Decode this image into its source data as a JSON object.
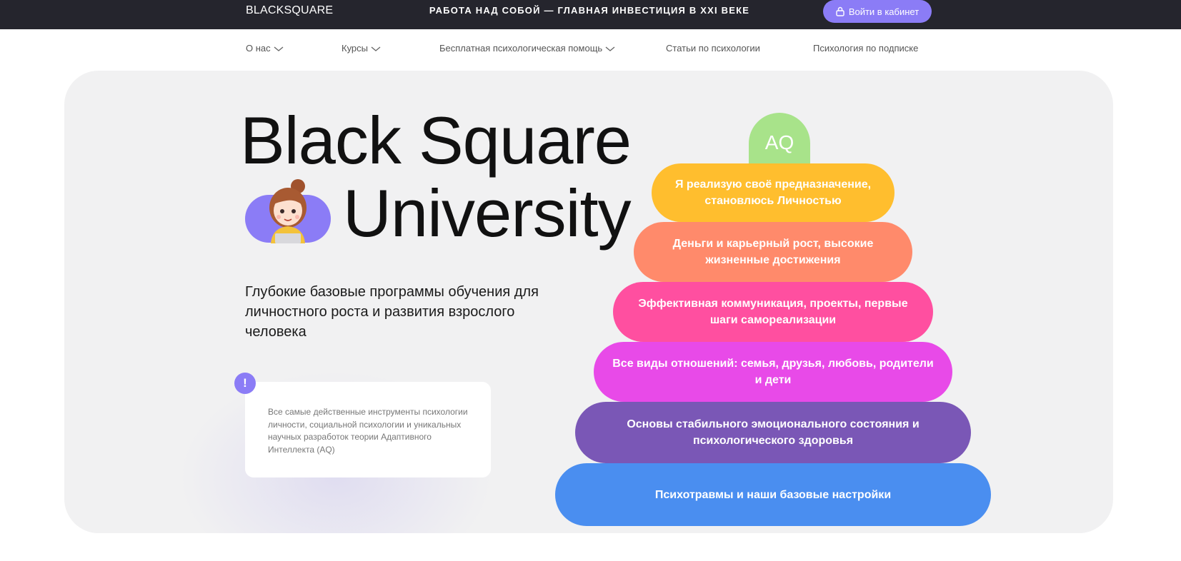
{
  "header": {
    "brand": "BLACKSQUARE",
    "tagline": "РАБОТА НАД СОБОЙ — ГЛАВНАЯ ИНВЕСТИЦИЯ В XXI ВЕКЕ",
    "login_label": "Войти в кабинет",
    "login_icon": "lock-icon"
  },
  "nav": {
    "items": [
      {
        "label": "О нас",
        "has_dropdown": true
      },
      {
        "label": "Курсы",
        "has_dropdown": true
      },
      {
        "label": "Бесплатная психологическая помощь",
        "has_dropdown": true
      },
      {
        "label": "Статьи по психологии",
        "has_dropdown": false
      },
      {
        "label": "Психология по подписке",
        "has_dropdown": false
      }
    ]
  },
  "hero": {
    "title_line1": "Black Square",
    "title_line2": "University",
    "subtitle": "Глубокие базовые программы обучения для личностного роста и развития взрослого человека",
    "note": "Все самые действенные инструменты психологии личности, социальной психологии и уникальных научных разработок теории Адаптивного Интеллекта (AQ)",
    "note_badge": "!"
  },
  "pyramid": {
    "cap": "AQ",
    "tiers": [
      {
        "text": "Я реализую своё предназначение, становлюсь Личностью",
        "color": "#ffbe2e"
      },
      {
        "text": "Деньги и карьерный рост, высокие жизненные достижения",
        "color": "#ff8a6b"
      },
      {
        "text": "Эффективная коммуникация, проекты, первые шаги самореализации",
        "color": "#ff4fa0"
      },
      {
        "text": "Все виды отношений: семья, друзья, любовь, родители и дети",
        "color": "#e84ae8"
      },
      {
        "text": "Основы стабильного эмоционального состояния и психологического здоровья",
        "color": "#7a57b6"
      },
      {
        "text": "Психотравмы и наши базовые настройки",
        "color": "#4a8ef0"
      }
    ]
  },
  "colors": {
    "topbar": "#25252d",
    "accent": "#8b7cf6",
    "hero_bg": "#f1f1f2",
    "aq_cap": "#a8e38a"
  }
}
